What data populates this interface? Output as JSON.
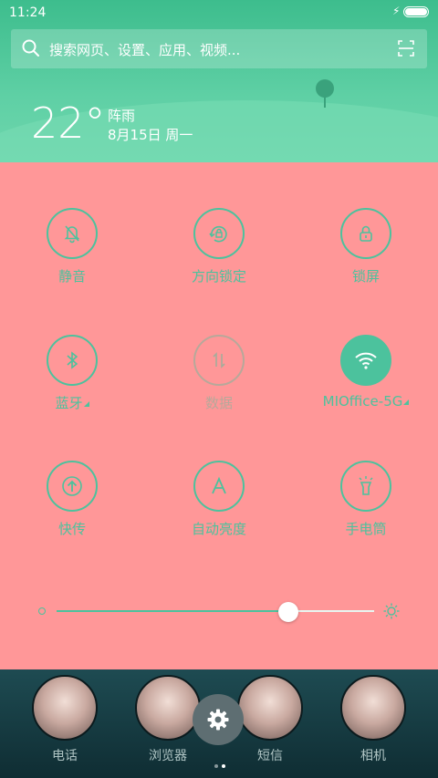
{
  "status_bar": {
    "time": "11:24",
    "battery_level": 1.0,
    "charging_icon": "bolt-icon"
  },
  "search": {
    "placeholder": "搜索网页、设置、应用、视频...",
    "icon": "search-icon",
    "scan_icon": "scan-icon"
  },
  "weather": {
    "temperature": "22°",
    "condition": "阵雨",
    "date": "8月15日 周一"
  },
  "toggles": [
    {
      "label": "静音",
      "icon": "mute-bell-icon",
      "state": "off"
    },
    {
      "label": "方向锁定",
      "icon": "rotation-lock-icon",
      "state": "off"
    },
    {
      "label": "锁屏",
      "icon": "lock-icon",
      "state": "off"
    },
    {
      "label": "蓝牙",
      "icon": "bluetooth-icon",
      "state": "off"
    },
    {
      "label": "数据",
      "icon": "mobile-data-icon",
      "state": "disabled"
    },
    {
      "label": "MIOffice-5G",
      "icon": "wifi-icon",
      "state": "on"
    },
    {
      "label": "快传",
      "icon": "quick-transfer-icon",
      "state": "off"
    },
    {
      "label": "自动亮度",
      "icon": "auto-brightness-icon",
      "state": "off"
    },
    {
      "label": "手电筒",
      "icon": "flashlight-icon",
      "state": "off"
    }
  ],
  "brightness": {
    "level": 0.73,
    "min_icon": "brightness-low-icon",
    "max_icon": "brightness-high-icon"
  },
  "dock": {
    "apps": [
      {
        "name": "电话"
      },
      {
        "name": "浏览器"
      },
      {
        "name": "短信"
      },
      {
        "name": "相机"
      }
    ],
    "settings_icon": "gear-icon",
    "page_count": 2,
    "active_page": 2
  },
  "colors": {
    "accent": "#4cc29d",
    "panel": "#ff9798",
    "header": "#3dbd8d"
  }
}
